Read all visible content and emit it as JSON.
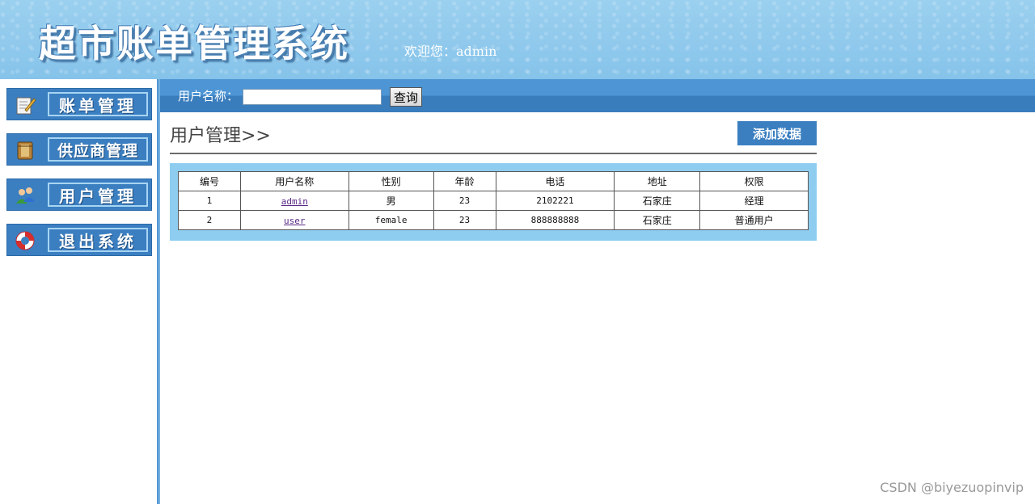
{
  "header": {
    "app_title": "超市账单管理系统",
    "welcome": "欢迎您：admin"
  },
  "sidebar": {
    "items": [
      {
        "label": "账单管理",
        "icon": "notepad-pencil-icon"
      },
      {
        "label": "供应商管理",
        "icon": "book-icon"
      },
      {
        "label": "用户管理",
        "icon": "users-icon"
      },
      {
        "label": "退出系统",
        "icon": "lifebuoy-icon"
      }
    ]
  },
  "search": {
    "label": "用户名称：",
    "value": "",
    "button_label": "查询"
  },
  "main": {
    "page_title": "用户管理>>",
    "add_button": "添加数据",
    "table": {
      "headers": [
        "编号",
        "用户名称",
        "性别",
        "年龄",
        "电话",
        "地址",
        "权限"
      ],
      "rows": [
        {
          "id": "1",
          "name": "admin",
          "gender": "男",
          "age": "23",
          "phone": "2102221",
          "address": "石家庄",
          "role": "经理"
        },
        {
          "id": "2",
          "name": "user",
          "gender": "female",
          "age": "23",
          "phone": "888888888",
          "address": "石家庄",
          "role": "普通用户"
        }
      ]
    }
  },
  "watermark": "CSDN @biyezuopinvip",
  "colors": {
    "header_bg": "#8ec8ec",
    "menu_blue": "#3b7fc1",
    "table_frame": "#8ecdf0",
    "link": "#5a2a86"
  }
}
